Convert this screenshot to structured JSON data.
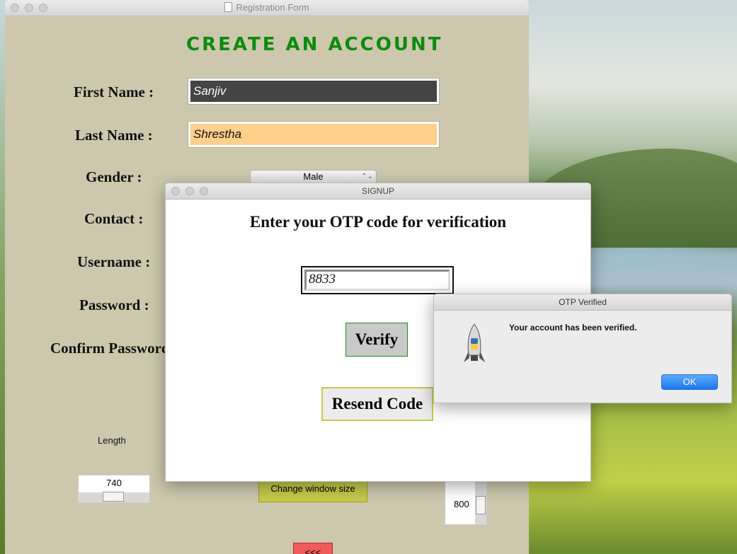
{
  "main_window": {
    "title": "Registration Form",
    "heading": "CREATE AN ACCOUNT",
    "labels": {
      "first_name": "First Name :",
      "last_name": "Last Name :",
      "gender": "Gender :",
      "contact": "Contact :",
      "username": "Username :",
      "password": "Password :",
      "confirm_password": "Confirm Password"
    },
    "fields": {
      "first_name": "Sanjiv",
      "last_name": "Shrestha",
      "gender": "Male"
    },
    "length_label": "Length",
    "length_value": "740",
    "change_size_label": "Change window size",
    "height_value": "800",
    "red_button_label": "<<<"
  },
  "signup_dialog": {
    "title": "SIGNUP",
    "prompt": "Enter your OTP code for verification",
    "otp_value": "8833",
    "verify_label": "Verify",
    "resend_label": "Resend Code"
  },
  "alert": {
    "title": "OTP Verified",
    "message": "Your account has been verified.",
    "ok_label": "OK",
    "icon": "python-rocket-icon"
  }
}
